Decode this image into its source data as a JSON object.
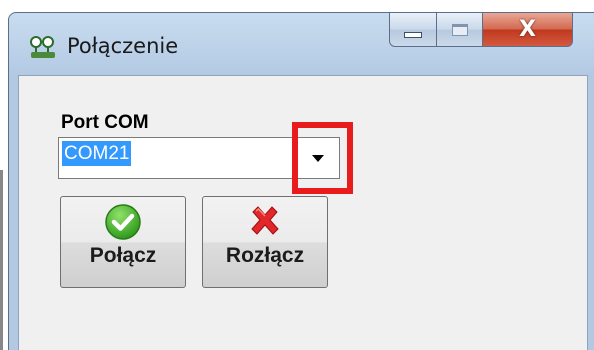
{
  "window": {
    "title": "Połączenie",
    "app_icon": "network-connection-icon",
    "caption_buttons": {
      "minimize_icon": "minimize-icon",
      "maximize_icon": "maximize-icon",
      "close_glyph": "X"
    }
  },
  "form": {
    "port_label": "Port COM",
    "port_combo": {
      "selected_value": "COM21",
      "dropdown_icon": "chevron-down-icon"
    }
  },
  "buttons": {
    "connect": {
      "label": "Połącz",
      "icon": "green-check-icon"
    },
    "disconnect": {
      "label": "Rozłącz",
      "icon": "red-x-icon"
    }
  },
  "annotation": {
    "highlight_color": "#e81c1c"
  },
  "colors": {
    "selection": "#3399ff",
    "titlebar": "#b9cfe7",
    "close_button": "#c7412a"
  }
}
